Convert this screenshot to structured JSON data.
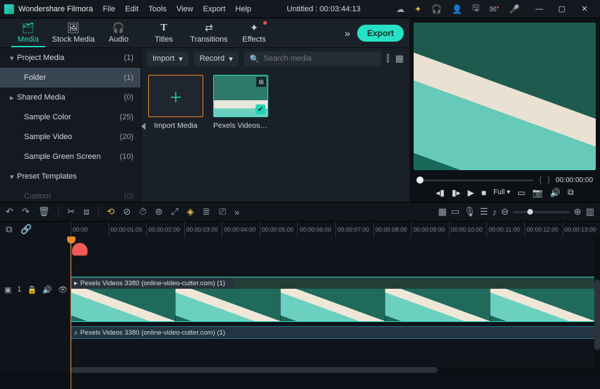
{
  "title": {
    "app": "Wondershare Filmora",
    "doc": "Untitled : 00:03:44:13"
  },
  "menu": [
    "File",
    "Edit",
    "Tools",
    "View",
    "Export",
    "Help"
  ],
  "header_icons": [
    "cloud",
    "sparkle",
    "headphones",
    "user",
    "save",
    "mail",
    "mic"
  ],
  "win": {
    "min": "—",
    "max": "▢",
    "close": "✕"
  },
  "tabs": [
    {
      "k": "media",
      "label": "Media",
      "icon": "🗂"
    },
    {
      "k": "stock",
      "label": "Stock Media",
      "icon": "🖼"
    },
    {
      "k": "audio",
      "label": "Audio",
      "icon": "🎧"
    },
    {
      "k": "titles",
      "label": "Titles",
      "icon": "T"
    },
    {
      "k": "transitions",
      "label": "Transitions",
      "icon": "⇄"
    },
    {
      "k": "effects",
      "label": "Effects",
      "icon": "✦",
      "dot": true
    }
  ],
  "export": "Export",
  "sidebar": {
    "items": [
      {
        "label": "Project Media",
        "count": "(1)",
        "caret": "▾",
        "group": true
      },
      {
        "label": "Folder",
        "count": "(1)",
        "child": true,
        "selected": true
      },
      {
        "label": "Shared Media",
        "count": "(0)",
        "caret": "▸",
        "group": true
      },
      {
        "label": "Sample Color",
        "count": "(25)",
        "child": true
      },
      {
        "label": "Sample Video",
        "count": "(20)",
        "child": true
      },
      {
        "label": "Sample Green Screen",
        "count": "(10)",
        "child": true
      },
      {
        "label": "Preset Templates",
        "count": "",
        "caret": "▾",
        "group": true
      },
      {
        "label": "Custom",
        "count": "(0)",
        "child": true,
        "faded": true
      }
    ],
    "footer": [
      "↻",
      "🗀",
      "⋯"
    ]
  },
  "toolbar": {
    "import": "Import",
    "record": "Record",
    "search_ph": "Search media"
  },
  "grid": {
    "import_label": "Import Media",
    "clip_label": "Pexels Videos 3…"
  },
  "player": {
    "tc": "00:00:00:00",
    "full": "Full ▾",
    "buttons": [
      "⏮",
      "⏵",
      "▶",
      "■"
    ]
  },
  "tl_icons_left": [
    "↶",
    "↷",
    "🗑"
  ],
  "tl_icons_mid": [
    "✂",
    "⧉",
    "⟲",
    "⊘",
    "⏱",
    "⊚",
    "⤡",
    "◈",
    "≣",
    "⎚",
    "»"
  ],
  "tl_icons_right": [
    "▦",
    "▭",
    "🎙",
    "☰",
    "♪",
    "⊖",
    "⊕",
    "▥"
  ],
  "ruler_left": [
    "⧉",
    "🔗"
  ],
  "ticks": [
    "00:00",
    "00:00:01:00",
    "00:00:02:00",
    "00:00:03:00",
    "00:00:04:00",
    "00:00:05:00",
    "00:00:06:00",
    "00:00:07:00",
    "00:00:08:00",
    "00:00:09:00",
    "00:00:10:00",
    "00:00:11:00",
    "00:00:12:00",
    "00:00:13:00"
  ],
  "gutter": {
    "track": "▢ 1",
    "lock": "🔒",
    "vol": "🔊",
    "eye": "👁"
  },
  "clip": {
    "video_title": "Pexels Videos 3380 (online-video-cutter.com) (1)",
    "audio_title": "Pexels Videos 3380 (online-video-cutter.com) (1)"
  }
}
